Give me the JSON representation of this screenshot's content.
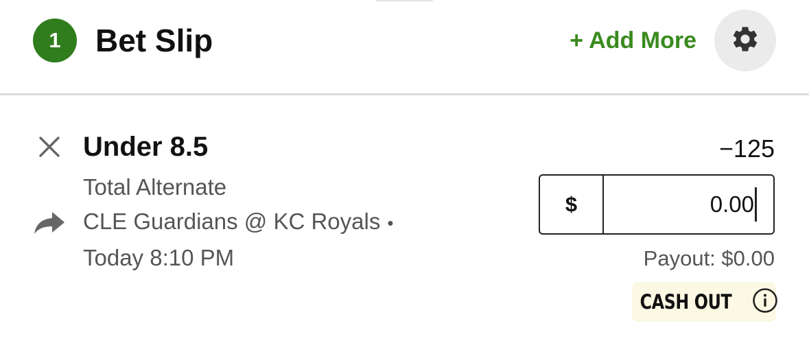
{
  "header": {
    "count": "1",
    "title": "Bet Slip",
    "add_more_label": "+ Add More",
    "settings_icon": "gear-icon"
  },
  "bet": {
    "selection": "Under 8.5",
    "market": "Total Alternate",
    "event": "CLE Guardians @ KC Royals",
    "event_separator": "•",
    "time": "Today 8:10 PM",
    "odds": "−125",
    "wager": {
      "currency": "$",
      "value": "0.00"
    },
    "payout": "Payout: $0.00",
    "cash_out_label": "CASH OUT",
    "icons": {
      "remove": "close-icon",
      "share": "share-arrow-icon",
      "info": "info-icon"
    }
  },
  "colors": {
    "brand_green": "#2f7d1c",
    "link_green": "#3a8a1e",
    "cashout_bg": "#fbf8e3"
  }
}
